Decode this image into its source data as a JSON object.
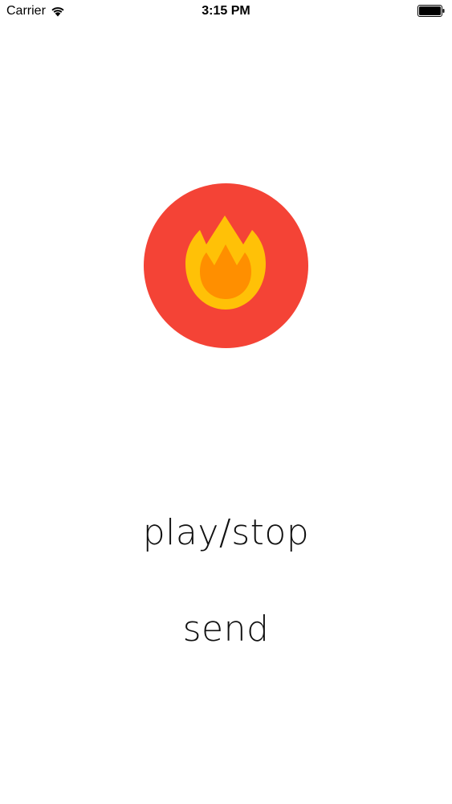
{
  "status_bar": {
    "carrier": "Carrier",
    "time": "3:15 PM",
    "wifi_icon": "wifi-icon",
    "battery_icon": "battery-icon"
  },
  "logo": {
    "icon": "flame-icon",
    "colors": {
      "circle": "#F44336",
      "flame_outer": "#FFC107",
      "flame_inner": "#FF8F00"
    }
  },
  "actions": {
    "play_stop_label": "play/stop",
    "send_label": "send"
  }
}
